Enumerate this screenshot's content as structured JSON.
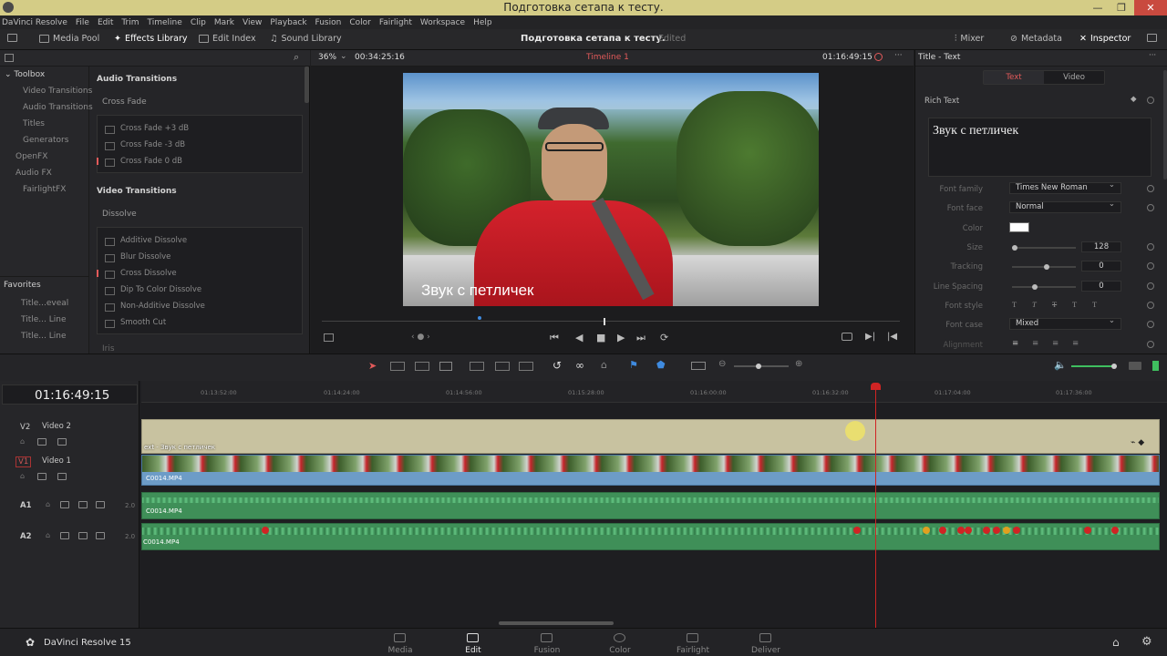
{
  "window": {
    "title": "Подготовка сетапа к тесту."
  },
  "menu": [
    "DaVinci Resolve",
    "File",
    "Edit",
    "Trim",
    "Timeline",
    "Clip",
    "Mark",
    "View",
    "Playback",
    "Fusion",
    "Color",
    "Fairlight",
    "Workspace",
    "Help"
  ],
  "toolbar": {
    "media_pool": "Media Pool",
    "effects_library": "Effects Library",
    "edit_index": "Edit Index",
    "sound_library": "Sound Library",
    "project_title": "Подготовка сетапа к тесту.",
    "project_status": "Edited",
    "mixer": "Mixer",
    "metadata": "Metadata",
    "inspector": "Inspector"
  },
  "toolbox": {
    "title": "Toolbox",
    "items": [
      "Video Transitions",
      "Audio Transitions",
      "Titles",
      "Generators"
    ],
    "openfx": "OpenFX",
    "audiofx": "Audio FX",
    "fairlightfx": "FairlightFX",
    "favorites_title": "Favorites",
    "favorites": [
      "Title...eveal",
      "Title... Line",
      "Title... Line"
    ]
  },
  "effects": {
    "audio_transitions": "Audio Transitions",
    "cross_fade": "Cross Fade",
    "audio_items": [
      "Cross Fade +3 dB",
      "Cross Fade -3 dB",
      "Cross Fade 0 dB"
    ],
    "video_transitions": "Video Transitions",
    "dissolve": "Dissolve",
    "video_items": [
      "Additive Dissolve",
      "Blur Dissolve",
      "Cross Dissolve",
      "Dip To Color Dissolve",
      "Non-Additive Dissolve",
      "Smooth Cut"
    ],
    "iris": "Iris"
  },
  "viewer": {
    "zoom": "36%",
    "source_tc": "00:34:25:16",
    "timeline_name": "Timeline 1",
    "record_tc": "01:16:49:15",
    "title_overlay": "Звук с петличек"
  },
  "inspector": {
    "header": "Title - Text",
    "tab_text": "Text",
    "tab_video": "Video",
    "rich_text": "Rich Text",
    "text_value": "Звук с петличек",
    "labels": {
      "font_family": "Font family",
      "font_face": "Font face",
      "color": "Color",
      "size": "Size",
      "tracking": "Tracking",
      "line_spacing": "Line Spacing",
      "font_style": "Font style",
      "font_case": "Font case",
      "alignment": "Alignment"
    },
    "font_family": "Times New Roman",
    "font_face": "Normal",
    "text_color": "#ffffff",
    "size": "128",
    "tracking": "0",
    "line_spacing": "0",
    "font_case": "Mixed",
    "font_style_glyphs": [
      "T",
      "T",
      "T",
      "T",
      "T"
    ]
  },
  "timeline": {
    "timecode": "01:16:49:15",
    "ruler": [
      "01:13:52:00",
      "01:14:24:00",
      "01:14:56:00",
      "01:15:28:00",
      "01:16:00:00",
      "01:16:32:00",
      "01:17:04:00",
      "01:17:36:00"
    ],
    "tracks": [
      {
        "id": "V2",
        "name": "Video 2",
        "clip": "ext - Звук с петличек"
      },
      {
        "id": "V1",
        "name": "Video 1",
        "clip": "C0014.MP4"
      },
      {
        "id": "A1",
        "name": "",
        "level": "2.0",
        "clip": "C0014.MP4"
      },
      {
        "id": "A2",
        "name": "",
        "level": "2.0",
        "clip": "C0014.MP4"
      }
    ]
  },
  "pages": [
    "Media",
    "Edit",
    "Fusion",
    "Color",
    "Fairlight",
    "Deliver"
  ],
  "app_name": "DaVinci Resolve 15",
  "colors": {
    "accent": "#e35a5a",
    "playhead": "#d02424",
    "title_clip": "#c8c2a0",
    "audio_clip": "#3f8f58",
    "video_clip": "#6d9cc7"
  }
}
